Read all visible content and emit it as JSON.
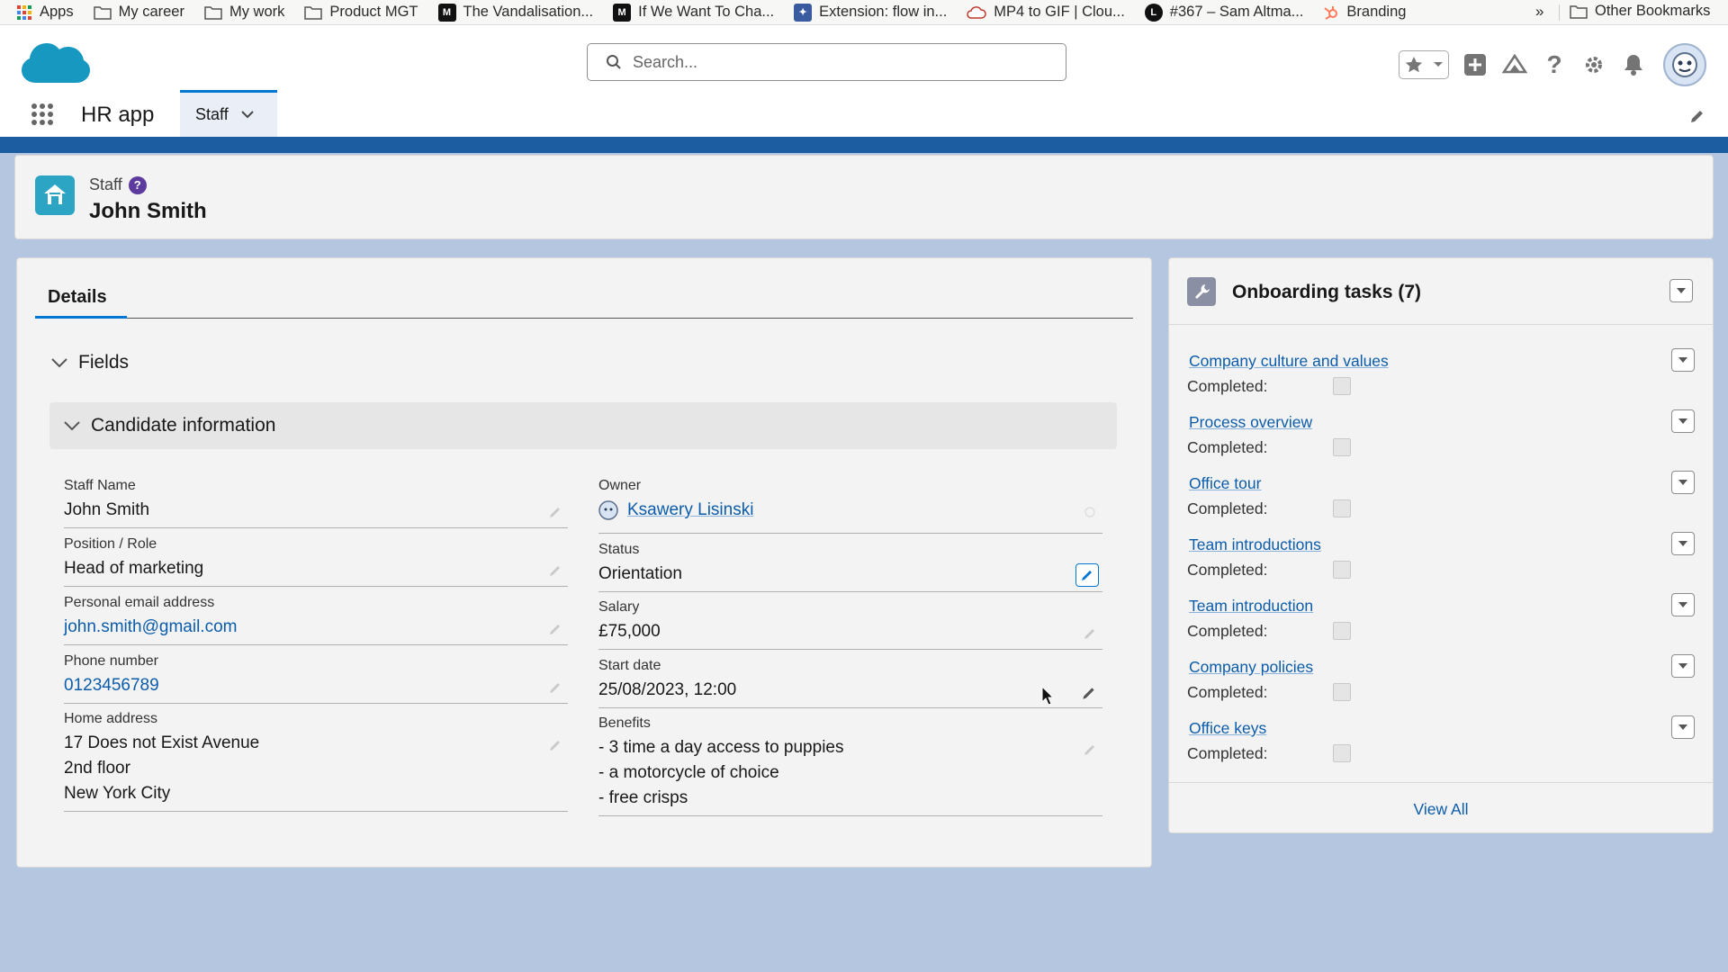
{
  "bookmarks": {
    "items": [
      {
        "label": "Apps",
        "icon": "apps-grid-icon"
      },
      {
        "label": "My career",
        "icon": "folder-icon"
      },
      {
        "label": "My work",
        "icon": "folder-icon"
      },
      {
        "label": "Product MGT",
        "icon": "folder-icon"
      },
      {
        "label": "The Vandalisation...",
        "icon": "medium-icon"
      },
      {
        "label": "If We Want To Cha...",
        "icon": "medium-icon"
      },
      {
        "label": "Extension: flow in...",
        "icon": "extension-icon"
      },
      {
        "label": "MP4 to GIF | Clou...",
        "icon": "cloud-icon"
      },
      {
        "label": "#367 – Sam Altma...",
        "icon": "podcast-icon"
      },
      {
        "label": "Branding",
        "icon": "hubspot-icon"
      }
    ],
    "more": "»",
    "other": "Other Bookmarks"
  },
  "header": {
    "search_placeholder": "Search...",
    "app_name": "HR app",
    "tab_label": "Staff"
  },
  "record": {
    "object": "Staff",
    "help": "?",
    "name": "John Smith"
  },
  "details": {
    "tab": "Details",
    "fields_section": "Fields",
    "candidate_section": "Candidate information",
    "left": [
      {
        "label": "Staff Name",
        "value": "John Smith"
      },
      {
        "label": "Position / Role",
        "value": "Head of marketing"
      },
      {
        "label": "Personal email address",
        "value": "john.smith@gmail.com"
      },
      {
        "label": "Phone number",
        "value": "0123456789"
      },
      {
        "label": "Home address",
        "line1": "17 Does not Exist Avenue",
        "line2": "2nd floor",
        "line3": "New York City"
      }
    ],
    "right": [
      {
        "label": "Owner",
        "value": "Ksawery Lisinski"
      },
      {
        "label": "Status",
        "value": "Orientation"
      },
      {
        "label": "Salary",
        "value": "£75,000"
      },
      {
        "label": "Start date",
        "value": "25/08/2023, 12:00"
      },
      {
        "label": "Benefits",
        "line1": "- 3 time a day access to puppies",
        "line2": "- a motorcycle of choice",
        "line3": "- free crisps"
      }
    ]
  },
  "tasks": {
    "title": "Onboarding tasks (7)",
    "completed_label": "Completed:",
    "items": [
      {
        "name": "Company culture and values"
      },
      {
        "name": "Process overview"
      },
      {
        "name": "Office tour"
      },
      {
        "name": "Team introductions"
      },
      {
        "name": "Team introduction"
      },
      {
        "name": "Company policies"
      },
      {
        "name": "Office keys"
      }
    ],
    "view_all": "View All"
  },
  "colors": {
    "brand_blue": "#0176d3",
    "link": "#0b5cab",
    "page_bg": "#b4c6e0",
    "record_icon": "#2ca5c5"
  }
}
